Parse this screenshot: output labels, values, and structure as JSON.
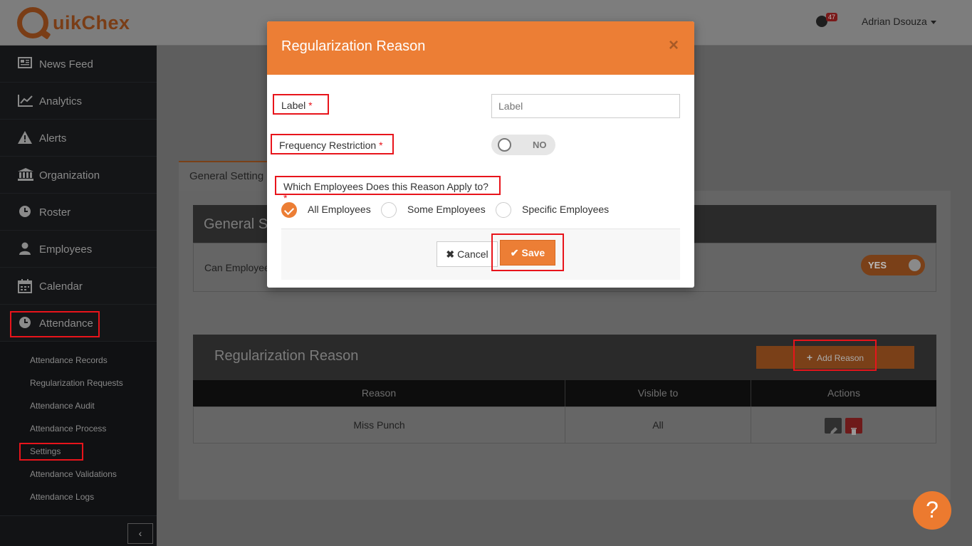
{
  "header": {
    "logo_text": "uikChex",
    "notification_count": "47",
    "user_name": "Adrian Dsouza"
  },
  "sidebar": {
    "items": [
      {
        "label": "News Feed",
        "icon": "newspaper-icon"
      },
      {
        "label": "Analytics",
        "icon": "line-chart-icon"
      },
      {
        "label": "Alerts",
        "icon": "warning-icon"
      },
      {
        "label": "Organization",
        "icon": "bank-icon"
      },
      {
        "label": "Roster",
        "icon": "clock-icon"
      },
      {
        "label": "Employees",
        "icon": "user-icon"
      },
      {
        "label": "Calendar",
        "icon": "calendar-icon"
      },
      {
        "label": "Attendance",
        "icon": "clock-icon"
      }
    ],
    "sub_items": [
      "Attendance Records",
      "Regularization Requests",
      "Attendance Audit",
      "Attendance Process",
      "Settings",
      "Attendance Validations",
      "Attendance Logs"
    ],
    "collapse_label": "‹"
  },
  "main": {
    "tab_label": "General Setting",
    "general_section_title": "General S",
    "general_row_text": "Can Employee",
    "general_toggle": "YES",
    "reason_section_title": "Regularization Reason",
    "add_reason_label": "Add Reason",
    "table": {
      "headers": [
        "Reason",
        "Visible to",
        "Actions"
      ],
      "rows": [
        {
          "reason": "Miss Punch",
          "visible_to": "All"
        }
      ]
    },
    "help_label": "?"
  },
  "modal": {
    "title": "Regularization Reason",
    "close_label": "×",
    "label_field": "Label",
    "label_placeholder": "Label",
    "frequency_field": "Frequency Restriction",
    "frequency_toggle": "NO",
    "employees_field": "Which Employees Does this Reason Apply to?",
    "required_mark": "*",
    "options": [
      "All Employees",
      "Some Employees",
      "Specific Employees"
    ],
    "selected_option": "All Employees",
    "cancel_label": "Cancel",
    "save_label": "Save"
  },
  "colors": {
    "accent": "#ec7e35",
    "highlight": "#e8141b",
    "sidebar_bg": "#141517"
  }
}
